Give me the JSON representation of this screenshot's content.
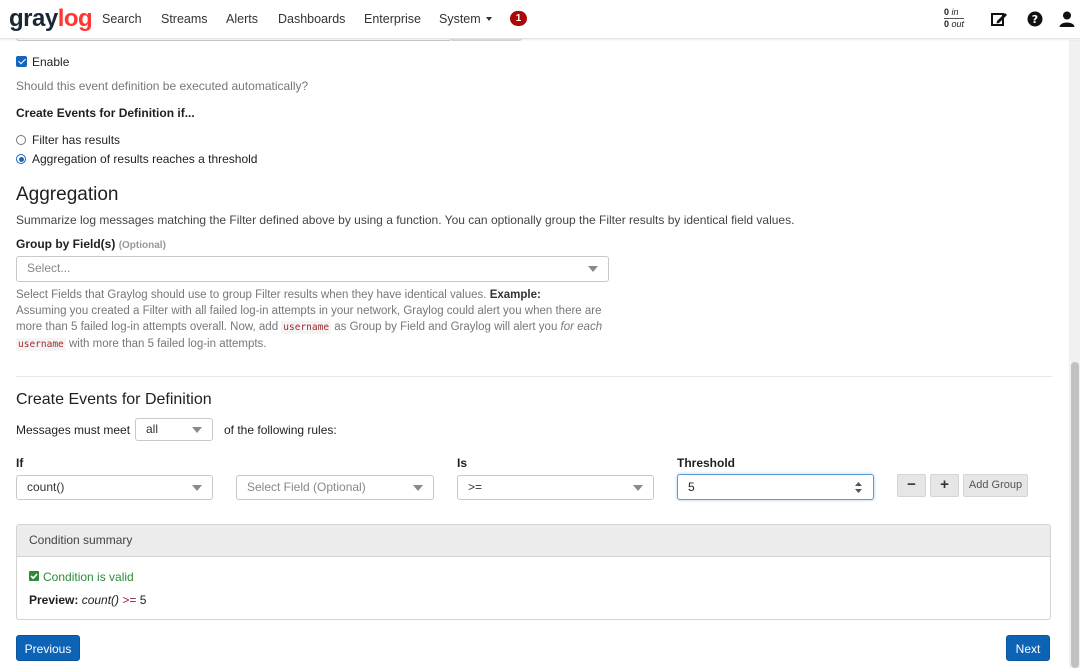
{
  "navbar": {
    "logo_part1": "gray",
    "logo_part2": "log",
    "items": [
      "Search",
      "Streams",
      "Alerts",
      "Dashboards",
      "Enterprise",
      "System"
    ],
    "notification_count": "1",
    "throughput_in_value": "0",
    "throughput_in_label": "in",
    "throughput_out_value": "0",
    "throughput_out_label": "out",
    "icons": [
      "edit-icon",
      "help-icon",
      "user-icon"
    ]
  },
  "enable": {
    "label": "Enable",
    "help": "Should this event definition be executed automatically?"
  },
  "create_events_if": {
    "label": "Create Events for Definition if...",
    "options": [
      "Filter has results",
      "Aggregation of results reaches a threshold"
    ],
    "selected": "Aggregation of results reaches a threshold"
  },
  "aggregation": {
    "title": "Aggregation",
    "description": "Summarize log messages matching the Filter defined above by using a function. You can optionally group the Filter results by identical field values.",
    "group_by_label": "Group by Field(s)",
    "group_by_optional": "(Optional)",
    "group_by_placeholder": "Select...",
    "help_line1_text": "Select Fields that Graylog should use to group Filter results when they have identical values.",
    "help_line1_bold": "Example:",
    "help_line2": "Assuming you created a Filter with all failed log-in attempts in your network, Graylog could alert you when there are",
    "help_line3_a": "more than 5 failed log-in attempts overall. Now, add",
    "help_code": "username",
    "help_line3_b": "as Group by Field and Graylog will alert you",
    "help_line3_em": "for each",
    "help_line4_b": "with more than 5 failed log-in attempts."
  },
  "definition": {
    "title": "Create Events for Definition",
    "messages_must_meet": "Messages must meet",
    "match_value": "all",
    "of_following_rules": "of the following rules:",
    "col_if": "If",
    "col_is": "Is",
    "col_threshold": "Threshold",
    "function_value": "count()",
    "field_placeholder": "Select Field (Optional)",
    "operator_value": ">=",
    "threshold_value": "5",
    "remove_label": "−",
    "add_label": "+",
    "add_group_label": "Add Group"
  },
  "summary": {
    "header": "Condition summary",
    "valid_text": "Condition is valid",
    "preview_label": "Preview:",
    "preview_func": "count()",
    "preview_op": ">=",
    "preview_value": "5"
  },
  "footer": {
    "previous_label": "Previous",
    "next_label": "Next"
  },
  "colors": {
    "primary": "#0d63b6",
    "logo_gray": "#1b2735",
    "logo_accent": "#ff3633",
    "badge": "#ad0707",
    "valid_green": "#2f8a3a"
  }
}
